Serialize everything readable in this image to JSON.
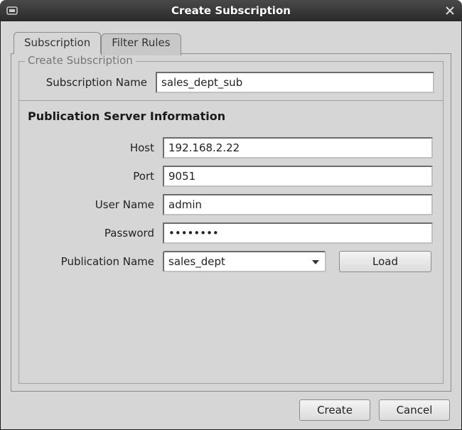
{
  "window": {
    "title": "Create Subscription"
  },
  "tabs": {
    "subscription": "Subscription",
    "filter_rules": "Filter Rules"
  },
  "group": {
    "title": "Create Subscription"
  },
  "labels": {
    "subscription_name": "Subscription Name",
    "section": "Publication Server Information",
    "host": "Host",
    "port": "Port",
    "user_name": "User Name",
    "password": "Password",
    "publication_name": "Publication Name"
  },
  "values": {
    "subscription_name": "sales_dept_sub",
    "host": "192.168.2.22",
    "port": "9051",
    "user_name": "admin",
    "password": "••••••••",
    "publication_selected": "sales_dept"
  },
  "buttons": {
    "load": "Load",
    "create": "Create",
    "cancel": "Cancel"
  }
}
